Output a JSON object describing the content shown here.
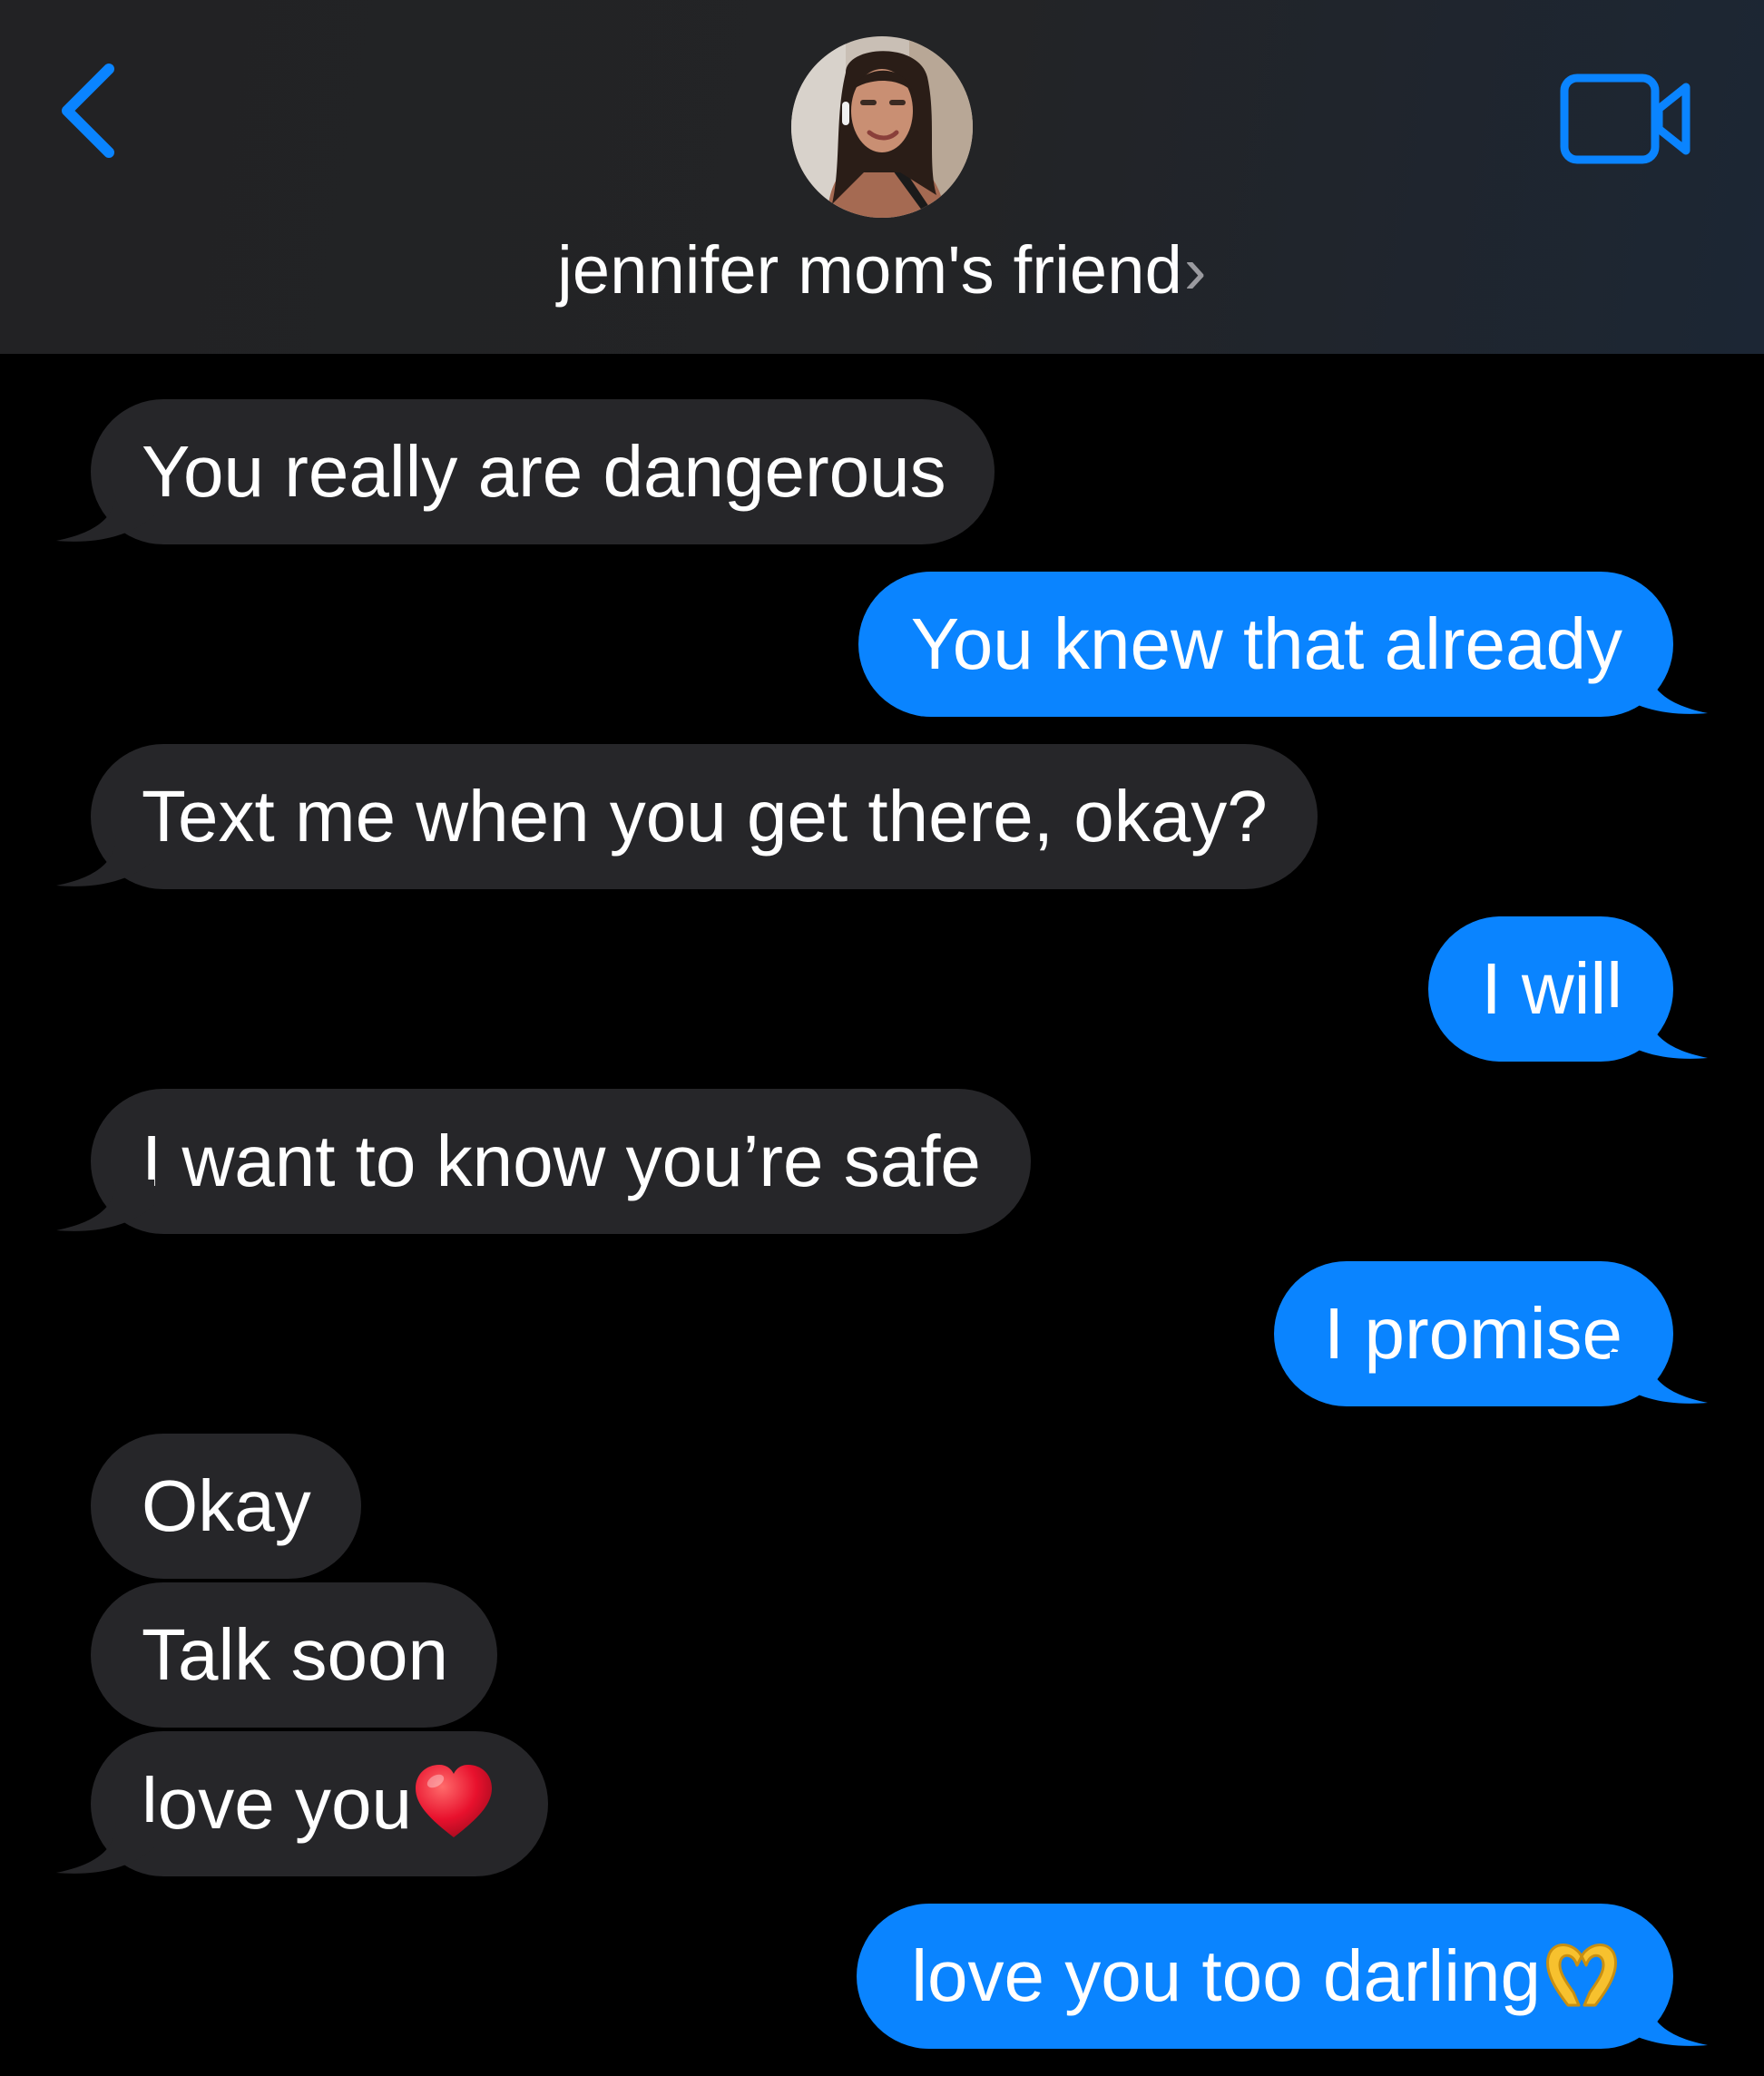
{
  "header": {
    "contact_name": "jennifer mom's friend",
    "contact_chevron": "›",
    "icons": {
      "back": "chevron-left-icon",
      "video": "video-camera-icon"
    },
    "accent_color": "#0a84ff"
  },
  "messages": [
    {
      "direction": "incoming",
      "text": "You really are dangerous"
    },
    {
      "direction": "outgoing",
      "text": "You knew that already"
    },
    {
      "direction": "incoming",
      "text": "Text me when you get there, okay?"
    },
    {
      "direction": "outgoing",
      "text": "I will"
    },
    {
      "direction": "incoming",
      "text": "I want to know you’re safe"
    },
    {
      "direction": "outgoing",
      "text": "I promise"
    },
    {
      "direction": "incoming",
      "text": "Okay"
    },
    {
      "direction": "incoming",
      "text": "Talk soon"
    },
    {
      "direction": "incoming",
      "text": "love you",
      "emoji": "red-heart-icon"
    },
    {
      "direction": "outgoing",
      "text": "love you too darling",
      "emoji": "heart-hands-icon"
    }
  ],
  "colors": {
    "incoming_bubble": "#262629",
    "outgoing_bubble": "#0a84ff",
    "background": "#000000"
  }
}
